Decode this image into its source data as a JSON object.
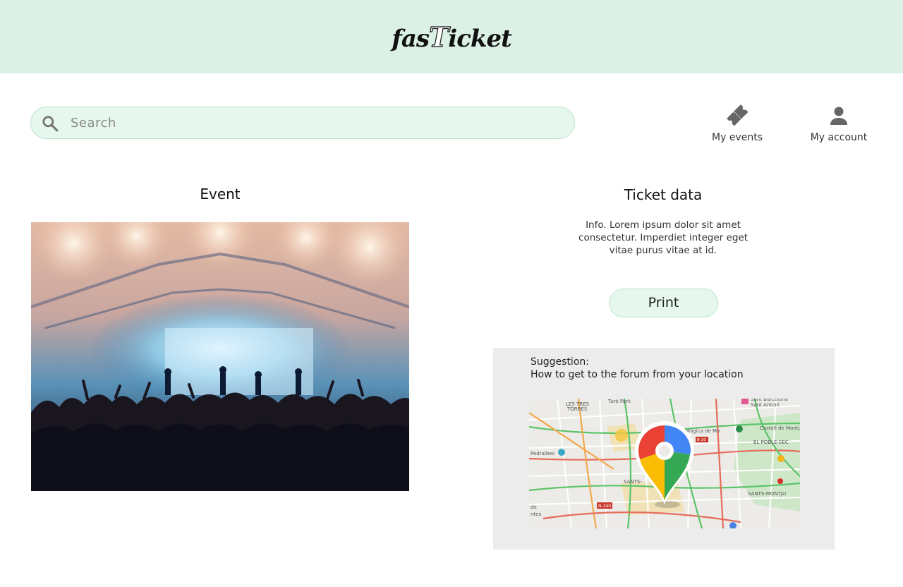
{
  "header": {
    "logo_prefix": "fas",
    "logo_t": "T",
    "logo_suffix": "icket"
  },
  "search": {
    "placeholder": "Search",
    "value": ""
  },
  "nav": {
    "my_events": "My events",
    "my_account": "My account"
  },
  "event": {
    "title": "Event"
  },
  "ticket": {
    "title": "Ticket data",
    "info_lines": [
      "Info. Lorem ipsum dolor sit amet",
      "consectetur. Imperdiet integer eget",
      "vitae purus vitae at id."
    ],
    "print_label": "Print"
  },
  "suggestion": {
    "heading": "Suggestion:",
    "text": "How to get to the forum from your location",
    "map_labels": [
      "LES TRES",
      "TORRES",
      "Turó Park",
      "Sant Barcelona",
      "Sant Antoni",
      "Màgica de Mo",
      "Castell de Montj",
      "EL POBLE-SEC",
      "Pedralbes",
      "SANTS-",
      "SANTS-MONTJU",
      "de",
      "ntes",
      "N-340",
      "B-20"
    ]
  },
  "colors": {
    "header_bg": "#dcf1e6",
    "accent_bg": "#e6f7ee",
    "accent_border": "#bfe3cf",
    "panel_bg": "#ececec"
  }
}
